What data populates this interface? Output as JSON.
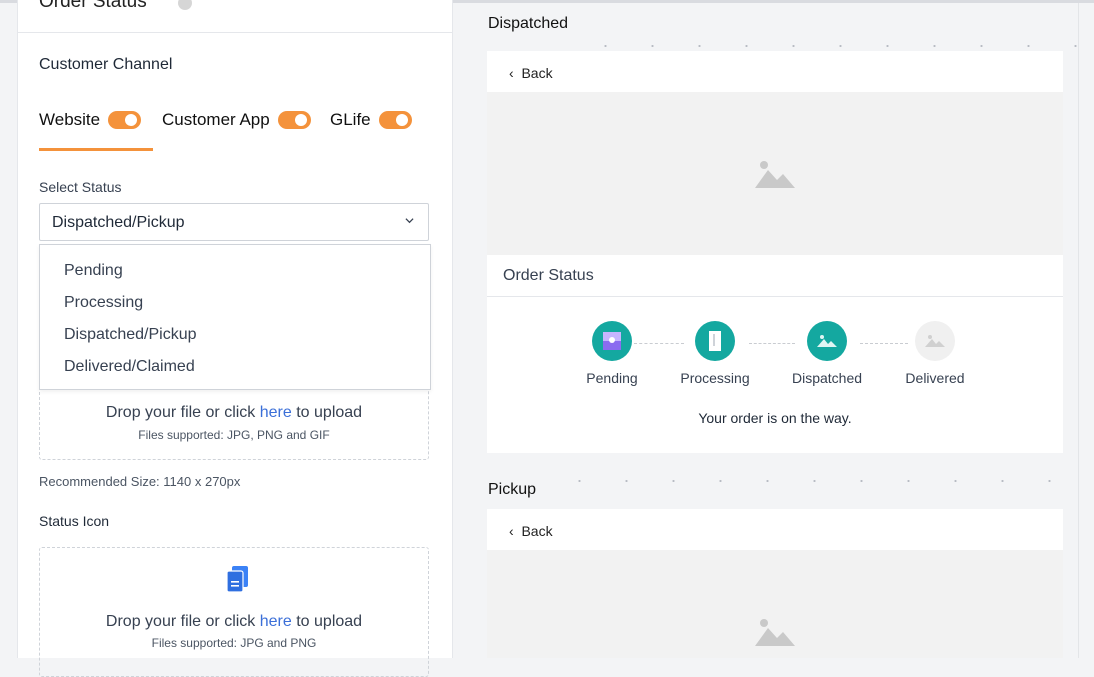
{
  "left": {
    "section_title": "Order Status",
    "customer_channel_label": "Customer Channel",
    "channels": [
      {
        "label": "Website",
        "enabled": true
      },
      {
        "label": "Customer App",
        "enabled": true
      },
      {
        "label": "GLife",
        "enabled": true
      }
    ],
    "select_status_label": "Select Status",
    "select_value": "Dispatched/Pickup",
    "dropdown_options": [
      "Pending",
      "Processing",
      "Dispatched/Pickup",
      "Delivered/Claimed"
    ],
    "upload1": {
      "text_before": "Drop your file or click ",
      "link": "here",
      "text_after": " to upload",
      "supported": "Files supported: JPG, PNG and GIF"
    },
    "recommended_size": "Recommended Size: 1140 x 270px",
    "status_icon_label": "Status Icon",
    "upload2": {
      "text_before": "Drop your file or click ",
      "link": "here",
      "text_after": " to upload",
      "supported": "Files supported: JPG and PNG"
    }
  },
  "right": {
    "dispatched_title": "Dispatched",
    "back_label": "Back",
    "order_status_title": "Order Status",
    "steps": [
      {
        "label": "Pending",
        "active": true
      },
      {
        "label": "Processing",
        "active": true
      },
      {
        "label": "Dispatched",
        "active": true
      },
      {
        "label": "Delivered",
        "active": false
      }
    ],
    "on_the_way": "Your order is on the way.",
    "pickup_title": "Pickup",
    "pickup_back_label": "Back"
  },
  "colors": {
    "accent_orange": "#f4923b",
    "teal": "#14a8a0",
    "link_blue": "#3b6fd8",
    "file_icon_blue": "#3b82f6"
  }
}
